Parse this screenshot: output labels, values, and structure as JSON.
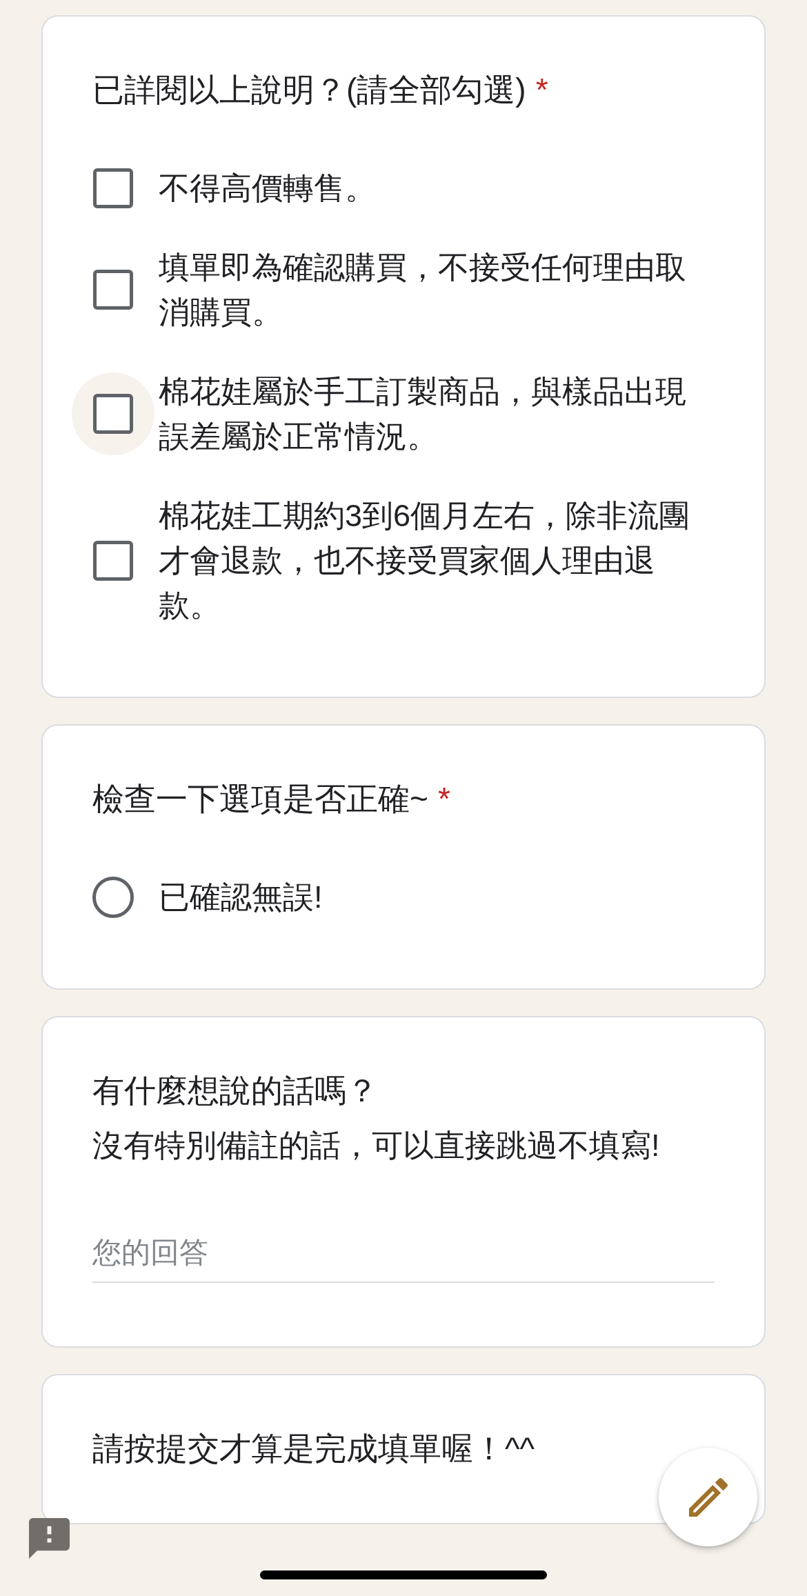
{
  "questions": [
    {
      "kind": "checkboxes",
      "title": "已詳閱以上說明？(請全部勾選)",
      "required_mark": "*",
      "options": [
        {
          "label": "不得高價轉售。",
          "checked": false,
          "highlighted": false
        },
        {
          "label": "填單即為確認購買，不接受任何理由取消購買。",
          "checked": false,
          "highlighted": false
        },
        {
          "label": "棉花娃屬於手工訂製商品，與樣品出現誤差屬於正常情況。",
          "checked": false,
          "highlighted": true
        },
        {
          "label": "棉花娃工期約3到6個月左右，除非流團才會退款，也不接受買家個人理由退款。",
          "checked": false,
          "highlighted": false
        }
      ]
    },
    {
      "kind": "radio",
      "title": "檢查一下選項是否正確~",
      "required_mark": "*",
      "options": [
        {
          "label": "已確認無誤!",
          "selected": false
        }
      ]
    },
    {
      "kind": "text",
      "title": "有什麼想說的話嗎？",
      "description": "沒有特別備註的話，可以直接跳過不填寫!",
      "placeholder": "您的回答"
    },
    {
      "kind": "note",
      "title": "請按提交才算是完成填單喔！^^"
    }
  ]
}
